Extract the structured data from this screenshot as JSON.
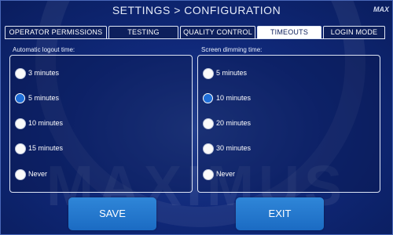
{
  "header": {
    "title": "SETTINGS > CONFIGURATION",
    "logo_text": "MAX"
  },
  "watermark": "MAXIMUS",
  "tabs": [
    {
      "label": "OPERATOR PERMISSIONS",
      "active": false
    },
    {
      "label": "TESTING",
      "active": false
    },
    {
      "label": "QUALITY CONTROL",
      "active": false
    },
    {
      "label": "TIMEOUTS",
      "active": true
    },
    {
      "label": "LOGIN MODE",
      "active": false
    }
  ],
  "logout": {
    "label": "Automatic logout time:",
    "options": [
      {
        "label": "3 minutes",
        "selected": false
      },
      {
        "label": "5 minutes",
        "selected": true
      },
      {
        "label": "10 minutes",
        "selected": false
      },
      {
        "label": "15 minutes",
        "selected": false
      },
      {
        "label": "Never",
        "selected": false
      }
    ]
  },
  "dimming": {
    "label": "Screen dimming time:",
    "options": [
      {
        "label": "5 minutes",
        "selected": false
      },
      {
        "label": "10 minutes",
        "selected": true
      },
      {
        "label": "20 minutes",
        "selected": false
      },
      {
        "label": "30 minutes",
        "selected": false
      },
      {
        "label": "Never",
        "selected": false
      }
    ]
  },
  "buttons": {
    "save": "SAVE",
    "exit": "EXIT"
  },
  "colors": {
    "background": "#0a1f66",
    "accent": "#1f6fd8",
    "button": "#2a7fd4"
  }
}
